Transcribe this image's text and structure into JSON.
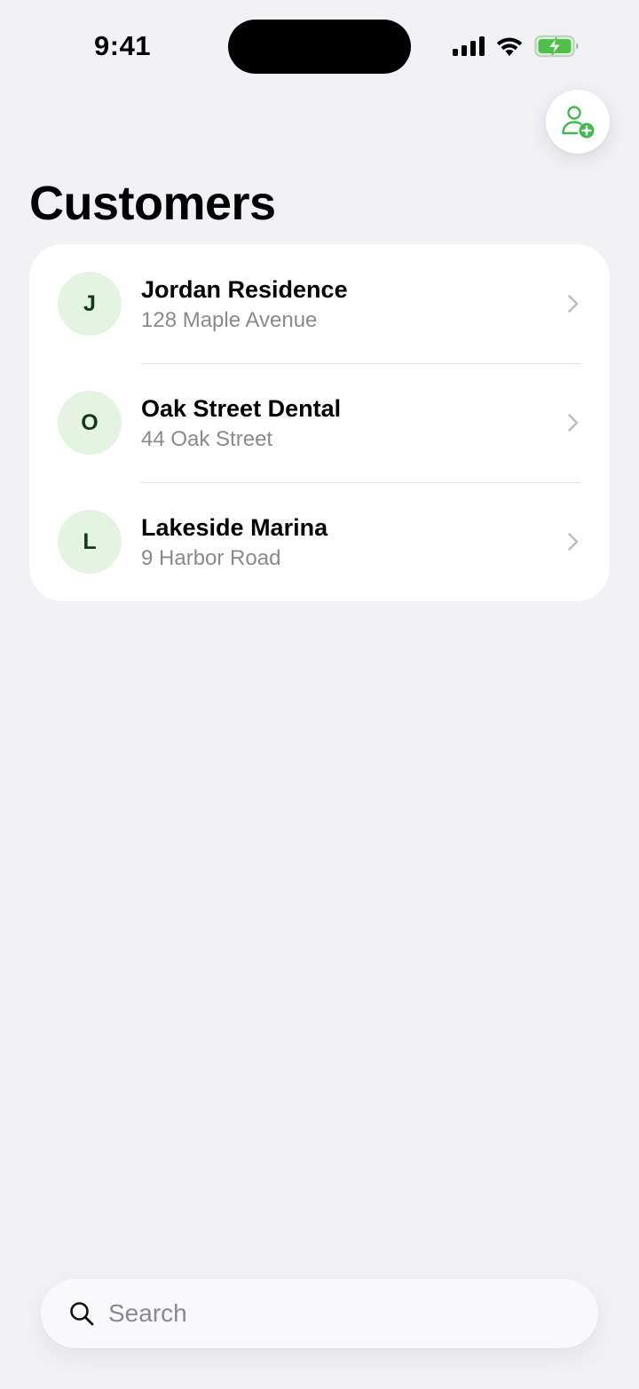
{
  "status_bar": {
    "time": "9:41",
    "icons": [
      "cellular-signal-icon",
      "wifi-icon",
      "battery-charging-icon"
    ]
  },
  "header": {
    "title": "Customers",
    "add_button_icon": "add-person-icon"
  },
  "customers": [
    {
      "initial": "J",
      "name": "Jordan Residence",
      "address": "128 Maple Avenue"
    },
    {
      "initial": "O",
      "name": "Oak Street Dental",
      "address": "44 Oak Street"
    },
    {
      "initial": "L",
      "name": "Lakeside Marina",
      "address": "9 Harbor Road"
    }
  ],
  "search": {
    "placeholder": "Search",
    "value": ""
  },
  "colors": {
    "background": "#f1f1f6",
    "accent_green": "#3fb950",
    "avatar_bg": "#e4f3e2",
    "avatar_text": "#143a1c",
    "secondary_text": "#8a8a8e"
  }
}
